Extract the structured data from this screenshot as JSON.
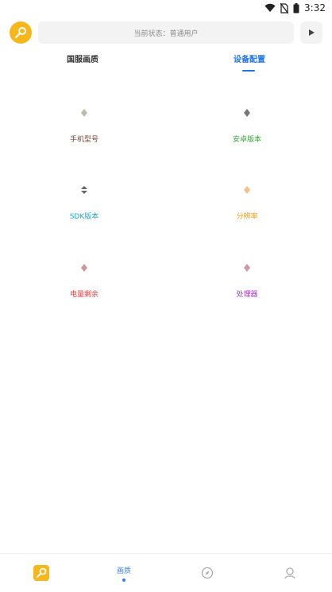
{
  "status_bar": {
    "time": "3:32",
    "icons": [
      "wifi-icon",
      "no-sim-icon",
      "battery-icon"
    ]
  },
  "top_bar": {
    "status_text": "当前状态：普通用户",
    "logo_icon": "wrench-logo-icon",
    "play_icon": "play-icon"
  },
  "tabs": [
    {
      "label": "国服画质",
      "active": false
    },
    {
      "label": "设备配置",
      "active": true
    }
  ],
  "device_items": [
    {
      "label": "手机型号",
      "color": "#7a4a3a",
      "icon": "phone-model-icon"
    },
    {
      "label": "安卓版本",
      "color": "#3aa03a",
      "icon": "android-version-icon"
    },
    {
      "label": "SDK版本",
      "color": "#1aa7c9",
      "icon": "sdk-version-icon"
    },
    {
      "label": "分辨率",
      "color": "#f39a1b",
      "icon": "resolution-icon"
    },
    {
      "label": "电量剩余",
      "color": "#e23b3b",
      "icon": "battery-remaining-icon"
    },
    {
      "label": "处理器",
      "color": "#a339c2",
      "icon": "processor-icon"
    }
  ],
  "bottom_nav": [
    {
      "icon": "wrench-logo-icon",
      "label": "",
      "active": false
    },
    {
      "icon": "quality-icon",
      "label": "画质",
      "active": true
    },
    {
      "icon": "compass-icon",
      "label": "",
      "active": false
    },
    {
      "icon": "profile-icon",
      "label": "",
      "active": false
    }
  ]
}
